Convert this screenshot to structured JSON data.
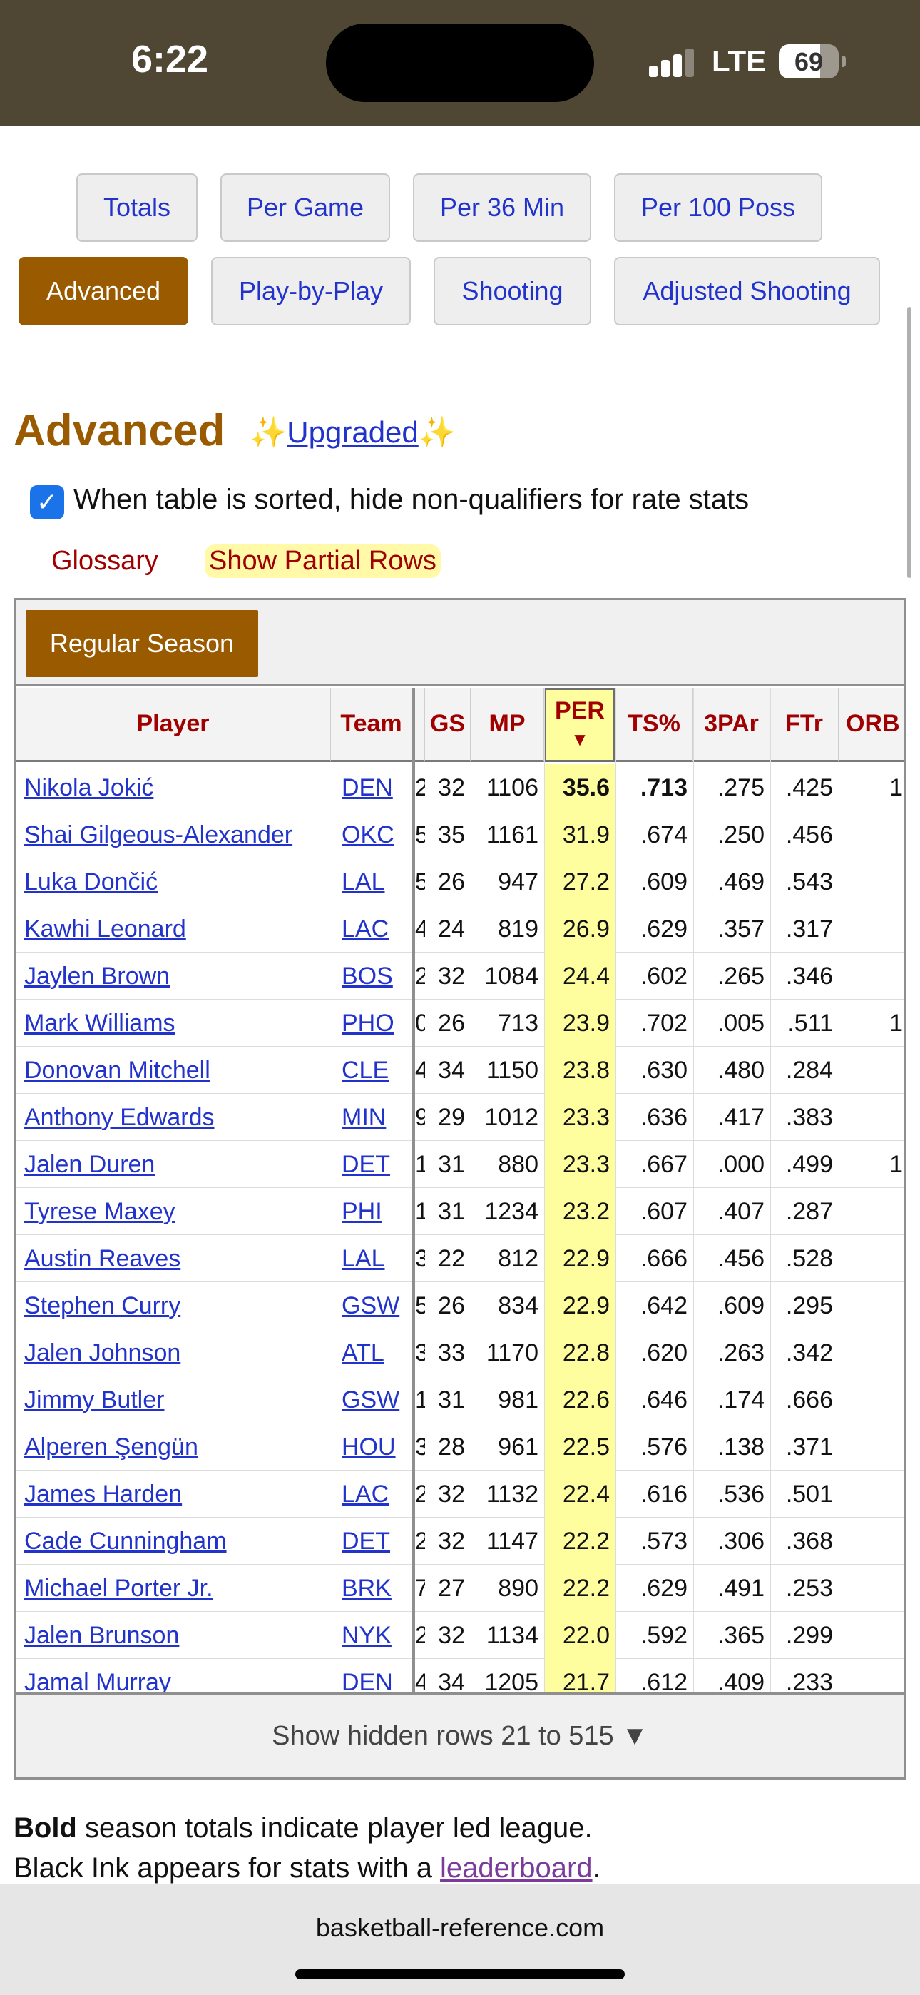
{
  "status": {
    "time": "6:22",
    "network": "LTE",
    "battery": "69",
    "battery_level": 0.69
  },
  "filters": {
    "row1": [
      "Totals",
      "Per Game",
      "Per 36 Min",
      "Per 100 Poss"
    ],
    "row2": [
      "Advanced",
      "Play-by-Play",
      "Shooting",
      "Adjusted Shooting"
    ],
    "active": "Advanced"
  },
  "section": {
    "title": "Advanced",
    "upgrade_sparkle": "✨",
    "upgrade_label": "Upgraded",
    "checkbox_label": "When table is sorted, hide non-qualifiers for rate stats",
    "checkbox_checked": true,
    "glossary": "Glossary",
    "partial_rows": "Show Partial Rows"
  },
  "table": {
    "season_tab": "Regular Season",
    "headers": {
      "player": "Player",
      "team": "Team",
      "gs": "GS",
      "mp": "MP",
      "per": "PER",
      "per_arrow": "▼",
      "ts": "TS%",
      "tpar": "3PAr",
      "ftr": "FTr",
      "orb": "ORB"
    },
    "rows": [
      {
        "player": "Nikola Jokić",
        "team": "DEN",
        "g": "2",
        "gs": "32",
        "mp": "1106",
        "per": "35.6",
        "ts": ".713",
        "tpar": ".275",
        "ftr": ".425",
        "orb": "1",
        "bold_per": true,
        "bold_ts": true
      },
      {
        "player": "Shai Gilgeous-Alexander",
        "team": "OKC",
        "g": "5",
        "gs": "35",
        "mp": "1161",
        "per": "31.9",
        "ts": ".674",
        "tpar": ".250",
        "ftr": ".456",
        "orb": ""
      },
      {
        "player": "Luka Dončić",
        "team": "LAL",
        "g": "5",
        "gs": "26",
        "mp": "947",
        "per": "27.2",
        "ts": ".609",
        "tpar": ".469",
        "ftr": ".543",
        "orb": ""
      },
      {
        "player": "Kawhi Leonard",
        "team": "LAC",
        "g": "4",
        "gs": "24",
        "mp": "819",
        "per": "26.9",
        "ts": ".629",
        "tpar": ".357",
        "ftr": ".317",
        "orb": ""
      },
      {
        "player": "Jaylen Brown",
        "team": "BOS",
        "g": "2",
        "gs": "32",
        "mp": "1084",
        "per": "24.4",
        "ts": ".602",
        "tpar": ".265",
        "ftr": ".346",
        "orb": ""
      },
      {
        "player": "Mark Williams",
        "team": "PHO",
        "g": "0",
        "gs": "26",
        "mp": "713",
        "per": "23.9",
        "ts": ".702",
        "tpar": ".005",
        "ftr": ".511",
        "orb": "1"
      },
      {
        "player": "Donovan Mitchell",
        "team": "CLE",
        "g": "4",
        "gs": "34",
        "mp": "1150",
        "per": "23.8",
        "ts": ".630",
        "tpar": ".480",
        "ftr": ".284",
        "orb": ""
      },
      {
        "player": "Anthony Edwards",
        "team": "MIN",
        "g": "9",
        "gs": "29",
        "mp": "1012",
        "per": "23.3",
        "ts": ".636",
        "tpar": ".417",
        "ftr": ".383",
        "orb": ""
      },
      {
        "player": "Jalen Duren",
        "team": "DET",
        "g": "1",
        "gs": "31",
        "mp": "880",
        "per": "23.3",
        "ts": ".667",
        "tpar": ".000",
        "ftr": ".499",
        "orb": "1"
      },
      {
        "player": "Tyrese Maxey",
        "team": "PHI",
        "g": "1",
        "gs": "31",
        "mp": "1234",
        "per": "23.2",
        "ts": ".607",
        "tpar": ".407",
        "ftr": ".287",
        "orb": ""
      },
      {
        "player": "Austin Reaves",
        "team": "LAL",
        "g": "3",
        "gs": "22",
        "mp": "812",
        "per": "22.9",
        "ts": ".666",
        "tpar": ".456",
        "ftr": ".528",
        "orb": ""
      },
      {
        "player": "Stephen Curry",
        "team": "GSW",
        "g": "5",
        "gs": "26",
        "mp": "834",
        "per": "22.9",
        "ts": ".642",
        "tpar": ".609",
        "ftr": ".295",
        "orb": ""
      },
      {
        "player": "Jalen Johnson",
        "team": "ATL",
        "g": "3",
        "gs": "33",
        "mp": "1170",
        "per": "22.8",
        "ts": ".620",
        "tpar": ".263",
        "ftr": ".342",
        "orb": ""
      },
      {
        "player": "Jimmy Butler",
        "team": "GSW",
        "g": "1",
        "gs": "31",
        "mp": "981",
        "per": "22.6",
        "ts": ".646",
        "tpar": ".174",
        "ftr": ".666",
        "orb": ""
      },
      {
        "player": "Alperen Şengün",
        "team": "HOU",
        "g": "3",
        "gs": "28",
        "mp": "961",
        "per": "22.5",
        "ts": ".576",
        "tpar": ".138",
        "ftr": ".371",
        "orb": ""
      },
      {
        "player": "James Harden",
        "team": "LAC",
        "g": "2",
        "gs": "32",
        "mp": "1132",
        "per": "22.4",
        "ts": ".616",
        "tpar": ".536",
        "ftr": ".501",
        "orb": ""
      },
      {
        "player": "Cade Cunningham",
        "team": "DET",
        "g": "2",
        "gs": "32",
        "mp": "1147",
        "per": "22.2",
        "ts": ".573",
        "tpar": ".306",
        "ftr": ".368",
        "orb": ""
      },
      {
        "player": "Michael Porter Jr.",
        "team": "BRK",
        "g": "7",
        "gs": "27",
        "mp": "890",
        "per": "22.2",
        "ts": ".629",
        "tpar": ".491",
        "ftr": ".253",
        "orb": ""
      },
      {
        "player": "Jalen Brunson",
        "team": "NYK",
        "g": "2",
        "gs": "32",
        "mp": "1134",
        "per": "22.0",
        "ts": ".592",
        "tpar": ".365",
        "ftr": ".299",
        "orb": ""
      },
      {
        "player": "Jamal Murray",
        "team": "DEN",
        "g": "4",
        "gs": "34",
        "mp": "1205",
        "per": "21.7",
        "ts": ".612",
        "tpar": ".409",
        "ftr": ".233",
        "orb": ""
      }
    ],
    "show_hidden": "Show hidden rows 21 to 515 ▼"
  },
  "notes": {
    "bold_word": "Bold",
    "bold_rest": " season totals indicate player led league.",
    "ink_text": "Black Ink appears for stats with a ",
    "leaderboard": "leaderboard",
    "ink_end": "."
  },
  "browser": {
    "url": "basketball-reference.com"
  },
  "colors": {
    "accent": "#9a5a00",
    "link": "#2233cc",
    "header_text": "#a00000",
    "highlight": "#fffe9e",
    "status_bar": "#4f4634"
  }
}
